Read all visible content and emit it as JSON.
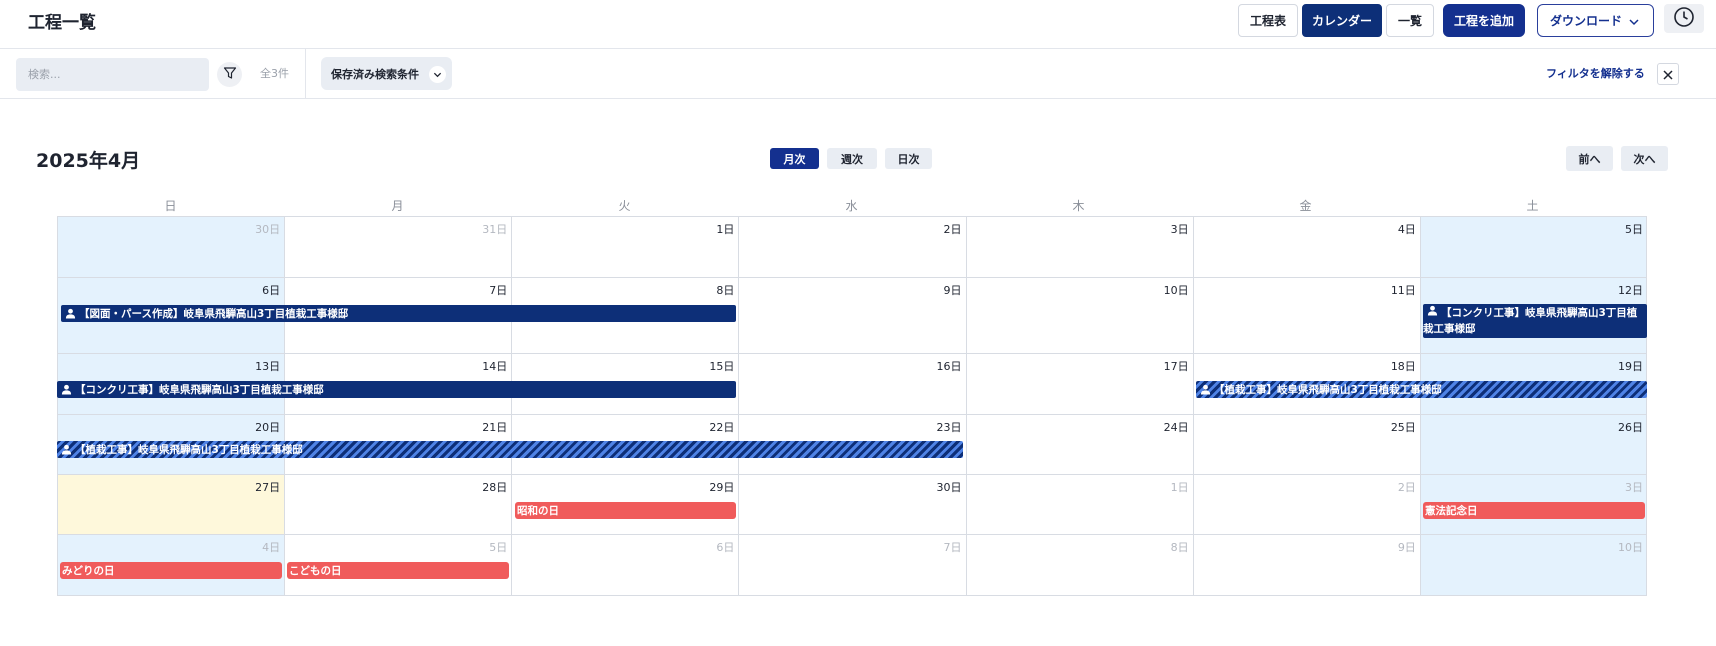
{
  "header": {
    "title": "工程一覧",
    "buttons": {
      "schedule_table": "工程表",
      "calendar": "カレンダー",
      "list": "一覧",
      "add": "工程を追加",
      "download": "ダウンロード"
    }
  },
  "filterbar": {
    "search_placeholder": "検索...",
    "count": "全3件",
    "saved_conditions": "保存済み検索条件",
    "clear_filter": "フィルタを解除する"
  },
  "calendar": {
    "month_title": "2025年4月",
    "views": {
      "month": "月次",
      "week": "週次",
      "day": "日次"
    },
    "nav": {
      "prev": "前へ",
      "next": "次へ"
    },
    "weekdays": [
      "日",
      "月",
      "火",
      "水",
      "木",
      "金",
      "土"
    ],
    "weeks": [
      [
        "30日",
        "31日",
        "1日",
        "2日",
        "3日",
        "4日",
        "5日"
      ],
      [
        "6日",
        "7日",
        "8日",
        "9日",
        "10日",
        "11日",
        "12日"
      ],
      [
        "13日",
        "14日",
        "15日",
        "16日",
        "17日",
        "18日",
        "19日"
      ],
      [
        "20日",
        "21日",
        "22日",
        "23日",
        "24日",
        "25日",
        "26日"
      ],
      [
        "27日",
        "28日",
        "29日",
        "30日",
        "1日",
        "2日",
        "3日"
      ],
      [
        "4日",
        "5日",
        "6日",
        "7日",
        "8日",
        "9日",
        "10日"
      ]
    ],
    "events": {
      "drawing": "【図面・パース作成】岐阜県飛騨高山3丁目植栽工事様邸",
      "concrete_w2": "【コンクリ工事】岐阜県飛騨高山3丁目植栽工事様邸",
      "concrete_w3": "【コンクリ工事】岐阜県飛騨高山3丁目植栽工事様邸",
      "planting_w3": "【植栽工事】岐阜県飛騨高山3丁目植栽工事様邸",
      "planting_w4": "【植栽工事】岐阜県飛騨高山3丁目植栽工事様邸"
    },
    "holidays": {
      "showa": "昭和の日",
      "kenpo": "憲法記念日",
      "midori": "みどりの日",
      "kodomo": "こどもの日"
    }
  },
  "colors": {
    "navy": "#0d2f78",
    "primary": "#14308f",
    "holiday": "#f05b5b",
    "weekend": "#e4f2fd",
    "today": "#fef8db"
  }
}
